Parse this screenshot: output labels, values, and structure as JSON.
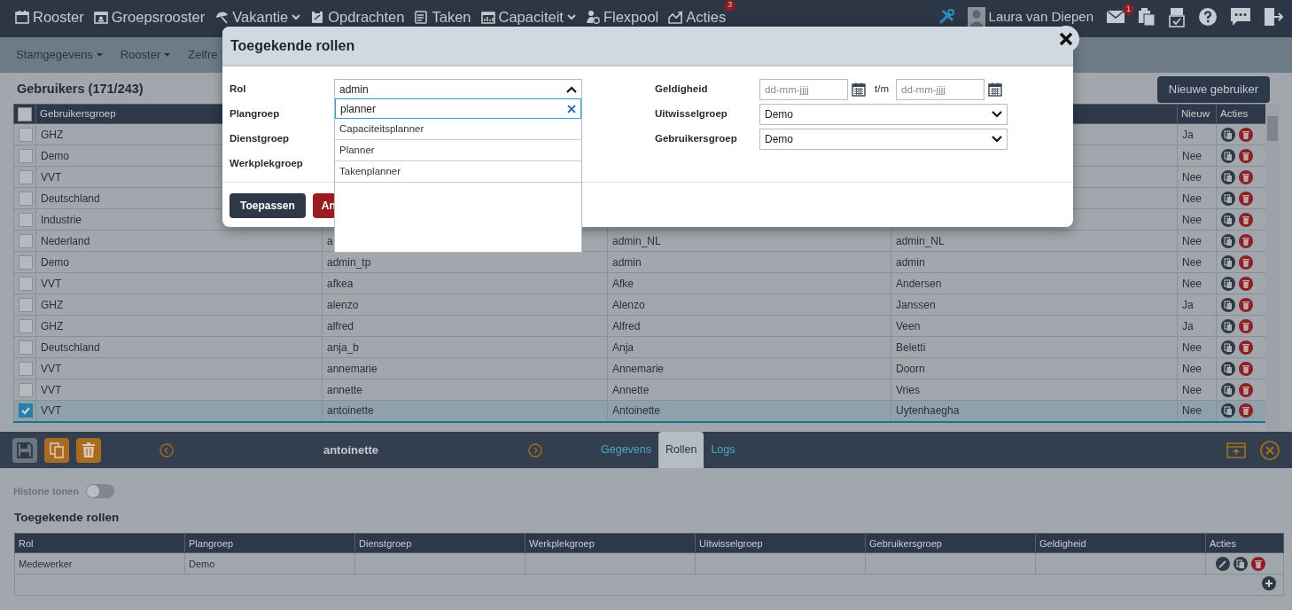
{
  "top_nav": {
    "items": [
      {
        "label": "Rooster",
        "dropdown": false
      },
      {
        "label": "Groepsrooster",
        "dropdown": false
      },
      {
        "label": "Vakantie",
        "dropdown": true
      },
      {
        "label": "Opdrachten",
        "dropdown": false
      },
      {
        "label": "Taken",
        "dropdown": false
      },
      {
        "label": "Capaciteit",
        "dropdown": true
      },
      {
        "label": "Flexpool",
        "dropdown": false
      },
      {
        "label": "Acties",
        "dropdown": false,
        "badge": "3"
      }
    ],
    "user": "Laura van Diepen",
    "mail_badge": "1"
  },
  "sub_nav": [
    {
      "label": "Stamgegevens",
      "dropdown": true
    },
    {
      "label": "Rooster",
      "dropdown": true
    },
    {
      "label": "Zelfre",
      "dropdown": false
    }
  ],
  "page": {
    "title": "Gebruikers (171/243)",
    "new_button": "Nieuwe gebruiker"
  },
  "users_table": {
    "all_selected": false,
    "first_column": "Gebruikersgroep",
    "new_column": "Nieuw",
    "actions_column": "Acties",
    "rows": [
      {
        "selected": false,
        "cells": [
          "GHZ"
        ],
        "nieuw": "Ja"
      },
      {
        "selected": false,
        "cells": [
          "Demo"
        ],
        "nieuw": "Nee"
      },
      {
        "selected": false,
        "cells": [
          "VVT"
        ],
        "nieuw": "Nee"
      },
      {
        "selected": false,
        "cells": [
          "Deutschland"
        ],
        "nieuw": "Nee"
      },
      {
        "selected": false,
        "cells": [
          "Industrie"
        ],
        "nieuw": "Nee"
      },
      {
        "selected": false,
        "cells": [
          "Nederland",
          "a",
          "admin_NL",
          "admin_NL"
        ],
        "nieuw": "Nee"
      },
      {
        "selected": false,
        "cells": [
          "Demo",
          "admin_tp",
          "admin",
          "admin"
        ],
        "nieuw": "Nee"
      },
      {
        "selected": false,
        "cells": [
          "VVT",
          "afkea",
          "Afke",
          "Andersen"
        ],
        "nieuw": "Nee"
      },
      {
        "selected": false,
        "cells": [
          "GHZ",
          "alenzo",
          "Alenzo",
          "Janssen"
        ],
        "nieuw": "Ja"
      },
      {
        "selected": false,
        "cells": [
          "GHZ",
          "alfred",
          "Alfred",
          "Veen"
        ],
        "nieuw": "Ja"
      },
      {
        "selected": false,
        "cells": [
          "Deutschland",
          "anja_b",
          "Anja",
          "Beletti"
        ],
        "nieuw": "Nee"
      },
      {
        "selected": false,
        "cells": [
          "VVT",
          "annemarie",
          "Annemarie",
          "Doorn"
        ],
        "nieuw": "Nee"
      },
      {
        "selected": false,
        "cells": [
          "VVT",
          "annette",
          "Annette",
          "Vries"
        ],
        "nieuw": "Nee"
      },
      {
        "selected": true,
        "cells": [
          "VVT",
          "antoinette",
          "Antoinette",
          "Uytenhaegha"
        ],
        "nieuw": "Nee"
      }
    ]
  },
  "modal": {
    "title": "Toegekende rollen",
    "left_fields": [
      {
        "label": "Rol",
        "value": "admin",
        "open": true
      },
      {
        "label": "Plangroep"
      },
      {
        "label": "Dienstgroep"
      },
      {
        "label": "Werkplekgroep"
      }
    ],
    "dropdown": {
      "search": "planner",
      "options": [
        {
          "label": "Capaciteitsplanner",
          "selected": false
        },
        {
          "label": "Planner",
          "selected": false
        },
        {
          "label": "Takenplanner",
          "selected": false
        }
      ]
    },
    "right_fields": [
      {
        "label": "Geldigheid",
        "kind": "daterange",
        "from_placeholder": "dd-mm-jjjj",
        "separator": "t/m",
        "to_placeholder": "dd-mm-jjjj"
      },
      {
        "label": "Uitwisselgroep",
        "kind": "select",
        "value": "Demo"
      },
      {
        "label": "Gebruikersgroep",
        "kind": "select",
        "value": "Demo"
      }
    ],
    "buttons": [
      {
        "label": "Toepassen",
        "kind": "primary"
      },
      {
        "label": "An",
        "kind": "danger"
      }
    ]
  },
  "detail": {
    "save_disabled": true,
    "record": "antoinette",
    "tabs": [
      {
        "label": "Gegevens",
        "selected": false
      },
      {
        "label": "Rollen",
        "selected": true
      },
      {
        "label": "Logs",
        "selected": false
      }
    ],
    "history": {
      "label": "Historie tonen",
      "on": false
    },
    "roles_title": "Toegekende rollen",
    "roles_table": {
      "columns": [
        "Rol",
        "Plangroep",
        "Dienstgroep",
        "Werkplekgroep",
        "Uitwisselgroep",
        "Gebruikersgroep",
        "Geldigheid",
        "Acties"
      ],
      "rows": [
        {
          "cells": [
            "Medewerker",
            "Demo"
          ]
        }
      ]
    }
  }
}
